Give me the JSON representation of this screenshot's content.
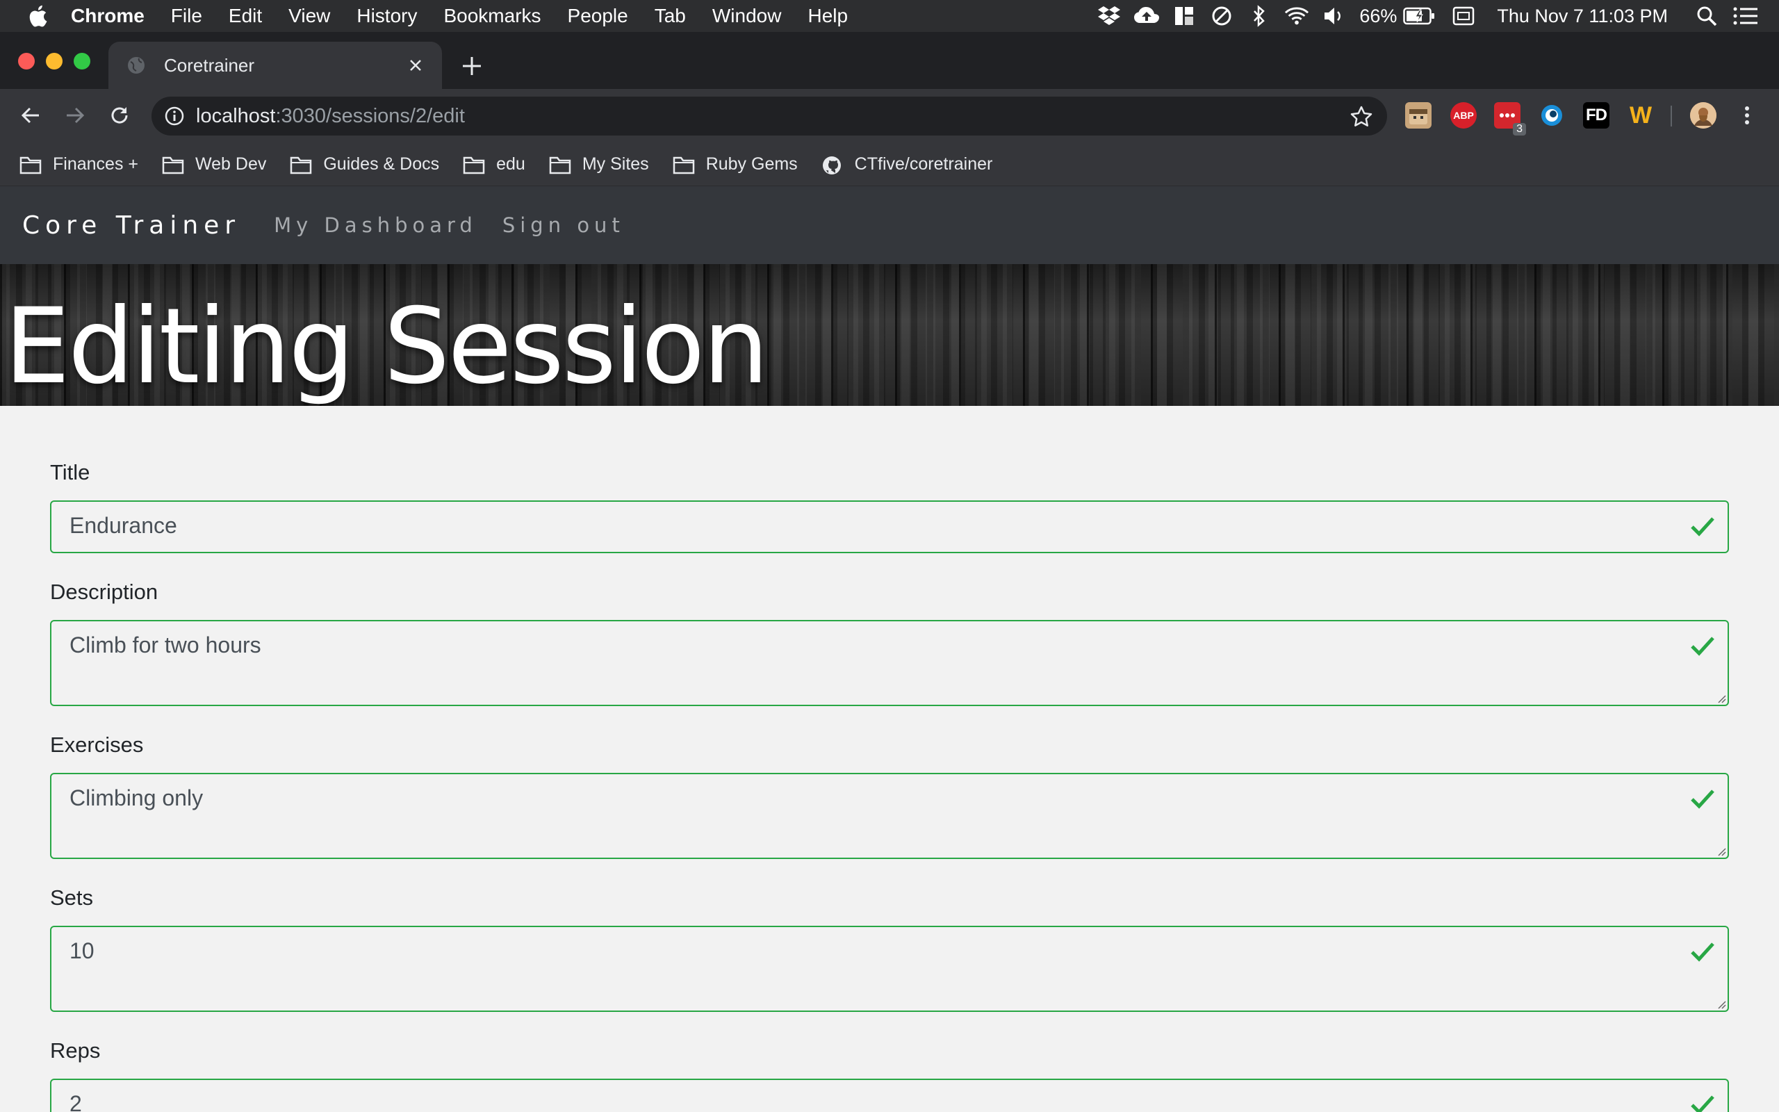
{
  "menubar": {
    "app_name": "Chrome",
    "items": [
      "File",
      "Edit",
      "View",
      "History",
      "Bookmarks",
      "People",
      "Tab",
      "Window",
      "Help"
    ],
    "battery": "66%",
    "clock": "Thu Nov 7  11:03 PM"
  },
  "browser": {
    "tab_title": "Coretrainer",
    "url_host": "localhost",
    "url_path": ":3030/sessions/2/edit",
    "extension_badge": "3",
    "extensions": [
      "ABP",
      "FD",
      "W"
    ]
  },
  "bookmarks": [
    "Finances +",
    "Web Dev",
    "Guides & Docs",
    "edu",
    "My Sites",
    "Ruby Gems",
    "CTfive/coretrainer"
  ],
  "site": {
    "brand": "Core Trainer",
    "nav": [
      "My Dashboard",
      "Sign out"
    ],
    "heading": "Editing Session"
  },
  "form": {
    "fields": [
      {
        "label": "Title",
        "value": "Endurance"
      },
      {
        "label": "Description",
        "value": "Climb for two hours"
      },
      {
        "label": "Exercises",
        "value": "Climbing only"
      },
      {
        "label": "Sets",
        "value": "10"
      },
      {
        "label": "Reps",
        "value": "2"
      }
    ]
  },
  "colors": {
    "valid_border": "#28a745",
    "page_bg": "#f2f2f2",
    "navbar_bg": "#34373c"
  }
}
